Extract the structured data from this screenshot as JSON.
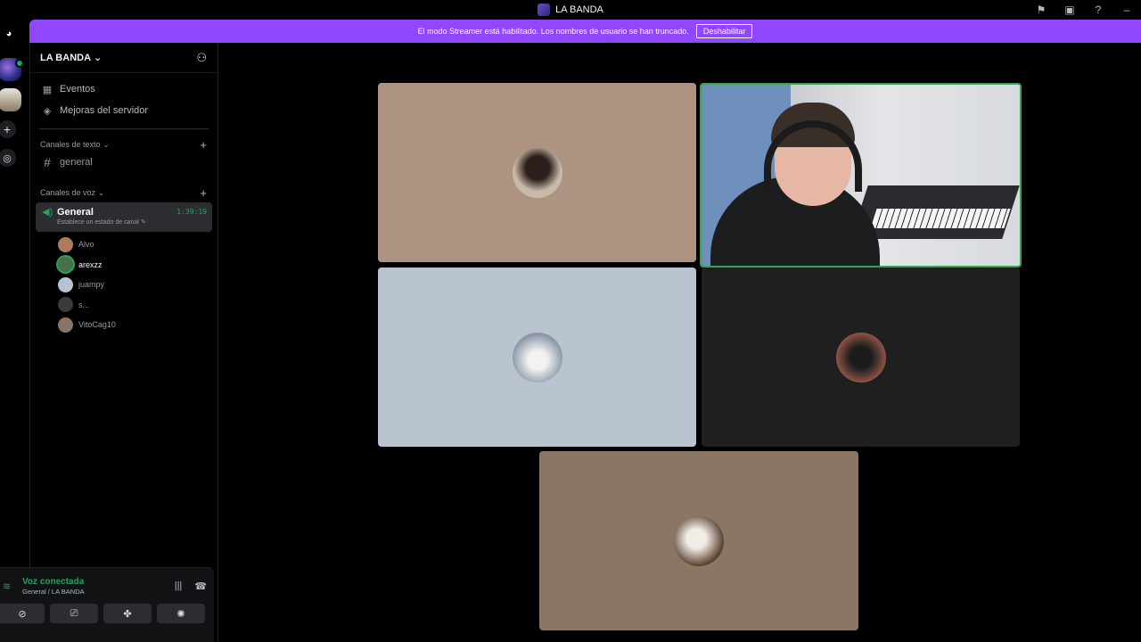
{
  "window": {
    "title": "LA BANDA",
    "controls": [
      "flag-icon",
      "screen-icon",
      "help-icon",
      "minimize-icon"
    ]
  },
  "streamer_banner": {
    "message": "El modo Streamer está habilitado. Los nombres de usuario se han truncado.",
    "button_label": "Deshabilitar"
  },
  "server": {
    "name": "LA BANDA",
    "menu": [
      {
        "label": "Eventos",
        "icon": "calendar-icon"
      },
      {
        "label": "Mejoras del servidor",
        "icon": "boost-icon"
      }
    ],
    "text_category": "Canales de texto",
    "text_channels": [
      {
        "label": "general"
      }
    ],
    "voice_category": "Canales de voz",
    "voice_channel": {
      "name": "General",
      "timer": "1:39:19",
      "status": "Establece un estado de canal"
    },
    "voice_users": [
      {
        "name": "Alvo",
        "speaking": false,
        "color": "#b07a60"
      },
      {
        "name": "arexzz",
        "speaking": true,
        "color": "#4b6e4b"
      },
      {
        "name": "juampy",
        "speaking": false,
        "color": "#b7c3d2"
      },
      {
        "name": "s...",
        "speaking": false,
        "color": "#3b3b3b"
      },
      {
        "name": "VitoCag10",
        "speaking": false,
        "color": "#8a7565"
      }
    ]
  },
  "voice_panel": {
    "status": "Voz conectada",
    "location": "General / LA BANDA"
  },
  "colors": {
    "accent": "#9146ff",
    "online": "#23a55a",
    "tile_1": "#ae9380",
    "tile_3": "#bac4d0",
    "tile_4": "#1e1f1e",
    "tile_5": "#8a7664"
  }
}
